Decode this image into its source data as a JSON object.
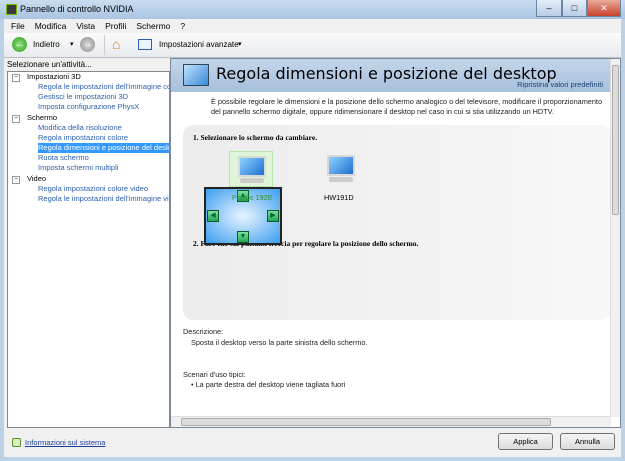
{
  "window": {
    "title": "Pannello di controllo NVIDIA",
    "min": "–",
    "max": "□",
    "close": "✕"
  },
  "menu": [
    "File",
    "Modifica",
    "Vista",
    "Profili",
    "Schermo",
    "?"
  ],
  "toolbar": {
    "back_label": "Indietro",
    "advanced_label": "Impostazioni avanzate"
  },
  "sidebar": {
    "caption": "Selezionare un'attività...",
    "categories": [
      {
        "label": "Impostazioni 3D",
        "items": [
          "Regola le impostazioni dell'immagine con an",
          "Gestisci le impostazioni 3D",
          "Imposta configurazione PhysX"
        ]
      },
      {
        "label": "Schermo",
        "items": [
          "Modifica della risoluzione",
          "Regola impostazioni colore",
          "Regola dimensioni e posizione del desktop",
          "Ruota schermo",
          "Imposta schermi multipli"
        ]
      },
      {
        "label": "Video",
        "items": [
          "Regola impostazioni colore video",
          "Regola le impostazioni dell'immagine video"
        ]
      }
    ],
    "selected": "Regola dimensioni e posizione del desktop",
    "system_info": "Informazioni sul sistema"
  },
  "main": {
    "title": "Regola dimensioni e posizione del desktop",
    "restore": "Ripristina valori predefiniti",
    "description": "È possibile regolare le dimensioni e la posizione dello schermo analogico o del televisore, modificare il proporzionamento del pannello schermo digitale, oppure ridimensionare il desktop nel caso in cui si stia utilizzando un HDTV.",
    "step1": "1. Selezionare lo schermo da cambiare.",
    "displays": [
      {
        "name": "Philips 192E",
        "selected": true
      },
      {
        "name": "HW191D",
        "selected": false
      }
    ],
    "step2": "2. Fare clic sui pulsanti freccia per regolare la posizione dello schermo.",
    "desc_label": "Descrizione:",
    "desc_text": "Sposta il desktop verso la parte sinistra dello schermo.",
    "usage_label": "Scenari d'uso tipici:",
    "usage_items": [
      "La parte destra del desktop viene tagliata fuori"
    ]
  },
  "buttons": {
    "apply": "Applica",
    "cancel": "Annulla"
  }
}
